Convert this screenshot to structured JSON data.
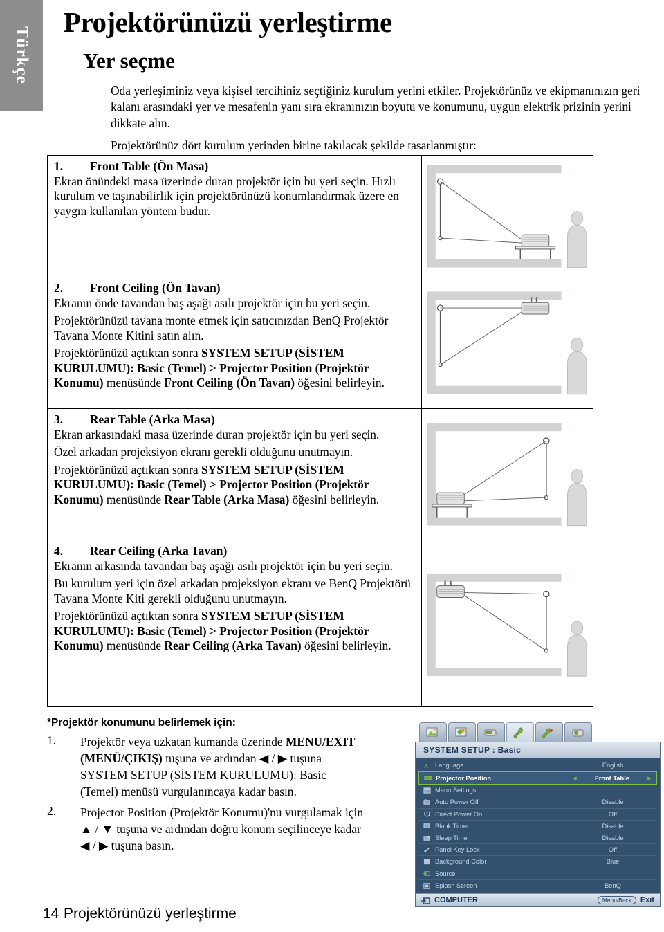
{
  "language_tab": {
    "label": "Türkçe"
  },
  "header": {
    "title": "Projektörünüzü yerleştirme",
    "subtitle": "Yer seçme"
  },
  "intro": {
    "paragraph1": "Oda yerleşiminiz veya kişisel tercihiniz seçtiğiniz kurulum yerini etkiler. Projektörünüz ve ekipmanınızın geri kalanı arasındaki yer ve mesafenin yanı sıra ekranınızın boyutu ve konumunu, uygun elektrik prizinin yerini dikkate alın.",
    "paragraph2": "Projektörünüz dört kurulum yerinden birine takılacak şekilde tasarlanmıştır:"
  },
  "positions": [
    {
      "number": "1.",
      "heading": "Front Table (Ön Masa)",
      "paragraphs": [
        "Ekran önündeki masa üzerinde duran projektör için bu yeri seçin. Hızlı kurulum ve taşınabilirlik için projektörünüzü konumlandırmak üzere en yaygın kullanılan yöntem budur."
      ],
      "illustration": "front-table-diagram"
    },
    {
      "number": "2.",
      "heading": "Front Ceiling (Ön Tavan)",
      "paragraphs": [
        "Ekranın önde tavandan baş aşağı asılı projektör için bu yeri seçin.",
        "Projektörünüzü tavana monte etmek için satıcınızdan BenQ Projektör Tavana Monte Kitini satın alın.",
        "Projektörünüzü açtıktan sonra SYSTEM SETUP (SİSTEM KURULUMU): Basic (Temel) > Projector Position (Projektör Konumu) menüsünde Front Ceiling (Ön Tavan) öğesini belirleyin."
      ],
      "illustration": "front-ceiling-diagram"
    },
    {
      "number": "3.",
      "heading": "Rear Table (Arka Masa)",
      "paragraphs": [
        "Ekran arkasındaki masa üzerinde duran projektör için bu yeri seçin.",
        "Özel arkadan projeksiyon ekranı gerekli olduğunu unutmayın.",
        "Projektörünüzü açtıktan sonra SYSTEM SETUP (SİSTEM KURULUMU): Basic (Temel) > Projector Position (Projektör Konumu) menüsünde Rear Table (Arka Masa) öğesini belirleyin."
      ],
      "illustration": "rear-table-diagram"
    },
    {
      "number": "4.",
      "heading": "Rear Ceiling (Arka Tavan)",
      "paragraphs": [
        "Ekranın arkasında tavandan baş aşağı asılı projektör için bu yeri seçin.",
        "Bu kurulum yeri için özel arkadan projeksiyon ekranı ve BenQ Projektörü Tavana Monte Kiti gerekli olduğunu unutmayın.",
        "Projektörünüzü açtıktan sonra SYSTEM SETUP (SİSTEM KURULUMU): Basic (Temel) > Projector Position (Projektör Konumu) menüsünde Rear Ceiling (Arka Tavan) öğesini belirleyin."
      ],
      "illustration": "rear-ceiling-diagram"
    }
  ],
  "procedure": {
    "heading": "*Projektör konumunu belirlemek için:",
    "steps": [
      {
        "number": "1.",
        "text": "Projektör veya uzkatan kumanda üzerinde MENU/EXIT (MENÜ/ÇIKIŞ) tuşuna ve ardından ◀ / ▶ tuşuna SYSTEM SETUP (SİSTEM KURULUMU): Basic (Temel) menüsü vurgulanıncaya kadar basın."
      },
      {
        "number": "2.",
        "text": "Projector Position (Projektör Konumu)'nu vurgulamak için ▲ / ▼ tuşuna ve ardından doğru konum seçilinceye kadar ◀ / ▶ tuşuna basın."
      }
    ]
  },
  "osd": {
    "tabs": [
      {
        "name": "picture-tab",
        "active": false
      },
      {
        "name": "picture-advanced-tab",
        "active": false
      },
      {
        "name": "display-tab",
        "active": false
      },
      {
        "name": "system-setup-basic-tab",
        "active": true
      },
      {
        "name": "system-setup-advanced-tab",
        "active": false
      },
      {
        "name": "information-tab",
        "active": false
      }
    ],
    "title": "SYSTEM SETUP : Basic",
    "rows": [
      {
        "icon": "language-icon",
        "label": "Language",
        "value": "English",
        "selected": false,
        "arrows": false
      },
      {
        "icon": "projector-position-icon",
        "label": "Projector Position",
        "value": "Front Table",
        "selected": true,
        "arrows": true
      },
      {
        "icon": "menu-settings-icon",
        "label": "Menu Settings",
        "value": "",
        "selected": false,
        "arrows": false
      },
      {
        "icon": "auto-power-off-icon",
        "label": "Auto Power Off",
        "value": "Disable",
        "selected": false,
        "arrows": false
      },
      {
        "icon": "direct-power-on-icon",
        "label": "Direct Power On",
        "value": "Off",
        "selected": false,
        "arrows": false
      },
      {
        "icon": "blank-timer-icon",
        "label": "Blank Timer",
        "value": "Disable",
        "selected": false,
        "arrows": false
      },
      {
        "icon": "sleep-timer-icon",
        "label": "Sleep Timer",
        "value": "Disable",
        "selected": false,
        "arrows": false
      },
      {
        "icon": "panel-key-lock-icon",
        "label": "Panel Key Lock",
        "value": "Off",
        "selected": false,
        "arrows": false
      },
      {
        "icon": "background-color-icon",
        "label": "Background Color",
        "value": "Blue",
        "selected": false,
        "arrows": false
      },
      {
        "icon": "source-icon",
        "label": "Source",
        "value": "",
        "selected": false,
        "arrows": false
      },
      {
        "icon": "splash-screen-icon",
        "label": "Splash Screen",
        "value": "BenQ",
        "selected": false,
        "arrows": false
      }
    ],
    "footer": {
      "source": "COMPUTER",
      "key_hint": "Menu/Back",
      "exit_label": "Exit"
    },
    "highlight_color": "#7bc043"
  },
  "footer": {
    "page_number": "14",
    "title": "Projektörünüzü yerleştirme"
  }
}
